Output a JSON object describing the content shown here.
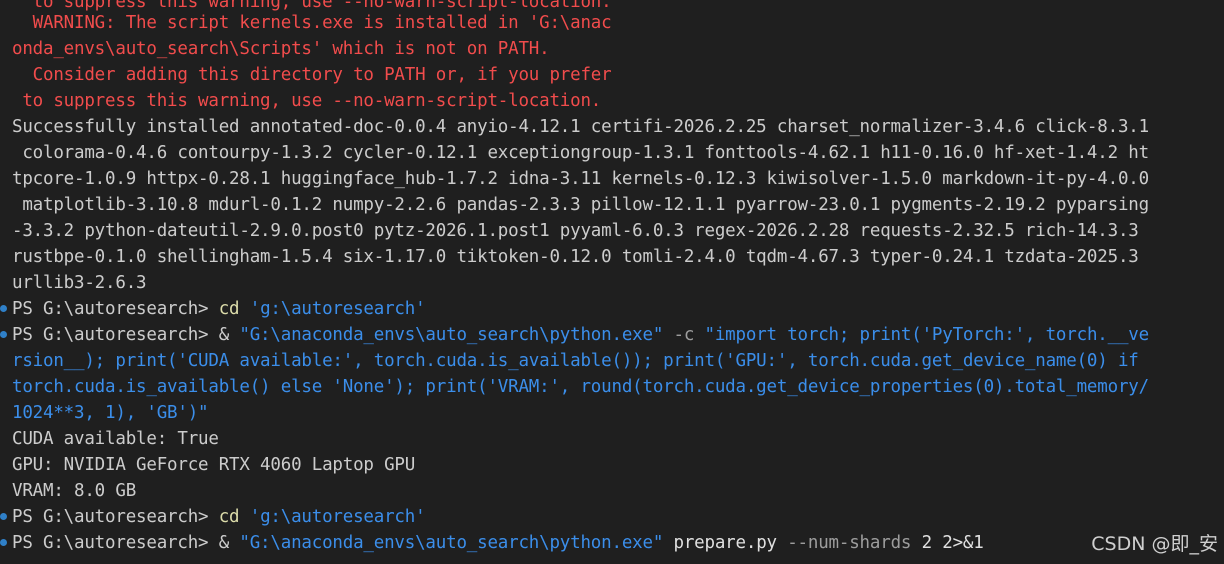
{
  "warnings": [
    "  to suppress this warning, use --no-warn-script-location.",
    "  WARNING: The script kernels.exe is installed in 'G:\\anac",
    "onda_envs\\auto_search\\Scripts' which is not on PATH.",
    "  Consider adding this directory to PATH or, if you prefer",
    " to suppress this warning, use --no-warn-script-location."
  ],
  "install_output": [
    "Successfully installed annotated-doc-0.0.4 anyio-4.12.1 certifi-2026.2.25 charset_normalizer-3.4.6 click-8.3.1",
    " colorama-0.4.6 contourpy-1.3.2 cycler-0.12.1 exceptiongroup-1.3.1 fonttools-4.62.1 h11-0.16.0 hf-xet-1.4.2 ht",
    "tpcore-1.0.9 httpx-0.28.1 huggingface_hub-1.7.2 idna-3.11 kernels-0.12.3 kiwisolver-1.5.0 markdown-it-py-4.0.0",
    " matplotlib-3.10.8 mdurl-0.1.2 numpy-2.2.6 pandas-2.3.3 pillow-12.1.1 pyarrow-23.0.1 pygments-2.19.2 pyparsing",
    "-3.3.2 python-dateutil-2.9.0.post0 pytz-2026.1.post1 pyyaml-6.0.3 regex-2026.2.28 requests-2.32.5 rich-14.3.3",
    "rustbpe-0.1.0 shellingham-1.5.4 six-1.17.0 tiktoken-0.12.0 tomli-2.4.0 tqdm-4.67.3 typer-0.24.1 tzdata-2025.3",
    "urllib3-2.6.3"
  ],
  "prompt": "PS G:\\autoresearch> ",
  "cmd1": {
    "kw": "cd",
    "arg": "'g:\\autoresearch'"
  },
  "cmd2": {
    "amp": "& ",
    "exe": "\"G:\\anaconda_envs\\auto_search\\python.exe\"",
    "flag": " -c ",
    "code_line1": "\"import torch; print('PyTorch:', torch.__ve",
    "code_line2": "rsion__); print('CUDA available:', torch.cuda.is_available()); print('GPU:', torch.cuda.get_device_name(0) if",
    "code_line3": "torch.cuda.is_available() else 'None'); print('VRAM:', round(torch.cuda.get_device_properties(0).total_memory/",
    "code_line4": "1024**3, 1), 'GB')\""
  },
  "results": [
    "CUDA available: True",
    "GPU: NVIDIA GeForce RTX 4060 Laptop GPU",
    "VRAM: 8.0 GB"
  ],
  "cmd3": {
    "kw": "cd",
    "arg": "'g:\\autoresearch'"
  },
  "cmd4": {
    "amp": "& ",
    "exe": "\"G:\\anaconda_envs\\auto_search\\python.exe\"",
    "script": " prepare.py",
    "flag": " --num-shards",
    "rest": " 2 2>&1"
  },
  "watermark": "CSDN @即_安",
  "colors": {
    "background": "#1f1f1f",
    "warning": "#f14c4c",
    "string": "#3b8eea",
    "keyword": "#dcdcaa",
    "prompt_dot": "#2f80c8"
  }
}
